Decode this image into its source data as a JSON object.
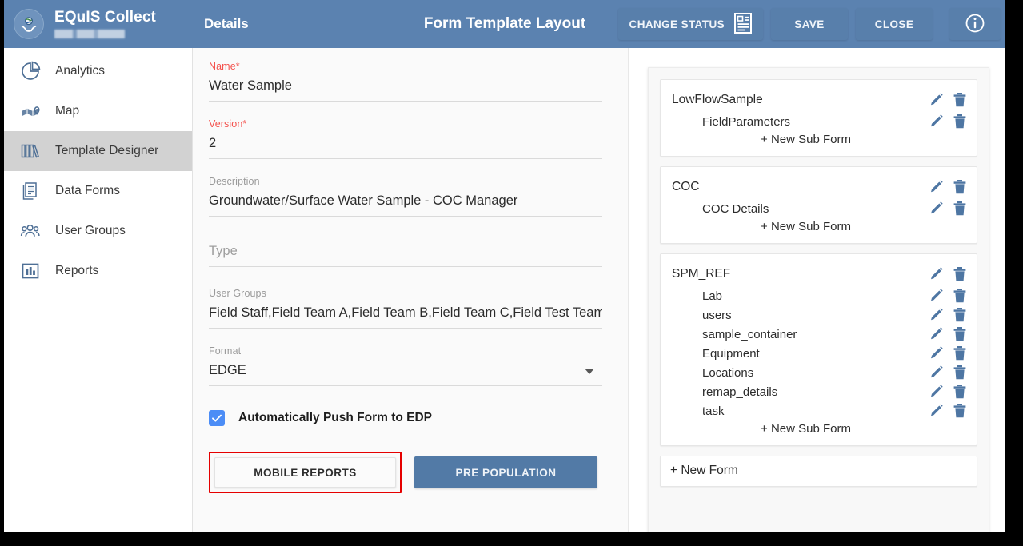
{
  "header": {
    "brand_title": "EQuIS Collect",
    "brand_subtitle_redacted": "",
    "nav_details": "Details",
    "page_title": "Form Template Layout",
    "buttons": {
      "change_status": "CHANGE STATUS",
      "save": "SAVE",
      "close": "CLOSE"
    },
    "icons": {
      "change_status": "form-document-icon",
      "info": "info-circle-icon",
      "logo": "equis-globe-hands-logo"
    },
    "accent_color": "#5b82b0",
    "button_color": "#587fab"
  },
  "sidebar": {
    "items": [
      {
        "label": "Analytics",
        "icon": "pie-chart-icon",
        "active": false
      },
      {
        "label": "Map",
        "icon": "map-icon",
        "active": false
      },
      {
        "label": "Template Designer",
        "icon": "books-icon",
        "active": true
      },
      {
        "label": "Data Forms",
        "icon": "documents-icon",
        "active": false
      },
      {
        "label": "User Groups",
        "icon": "people-icon",
        "active": false
      },
      {
        "label": "Reports",
        "icon": "bar-chart-icon",
        "active": false
      }
    ],
    "active_bg": "#d2d2d2"
  },
  "details_form": {
    "name": {
      "label": "Name",
      "required": true,
      "value": "Water Sample"
    },
    "version": {
      "label": "Version",
      "required": true,
      "value": "2"
    },
    "description": {
      "label": "Description",
      "required": false,
      "value": "Groundwater/Surface Water Sample - COC Manager"
    },
    "type": {
      "label": "",
      "required": false,
      "placeholder": "Type",
      "value": ""
    },
    "user_groups": {
      "label": "User Groups",
      "required": false,
      "value": "Field Staff,Field Team A,Field Team B,Field Team C,Field Test Team"
    },
    "format": {
      "label": "Format",
      "required": false,
      "value": "EDGE",
      "control": "select"
    },
    "auto_push": {
      "label": "Automatically Push Form to EDP",
      "checked": true,
      "color": "#4c8df6"
    },
    "buttons": {
      "mobile_reports": "MOBILE REPORTS",
      "pre_population": "PRE POPULATION"
    },
    "highlight_color": "#e50000",
    "required_color": "#f4524d"
  },
  "forms_panel": {
    "new_sub_form_label": "+ New Sub Form",
    "new_form_label": "+ New Form",
    "row_icons": {
      "edit": "pencil-icon",
      "delete": "trash-icon"
    },
    "icon_color": "#4e76a3",
    "cards": [
      {
        "title": "LowFlowSample",
        "subforms": [
          "FieldParameters"
        ]
      },
      {
        "title": "COC",
        "subforms": [
          "COC Details"
        ]
      },
      {
        "title": "SPM_REF",
        "subforms": [
          "Lab",
          "users",
          "sample_container",
          "Equipment",
          "Locations",
          "remap_details",
          "task"
        ]
      }
    ]
  }
}
